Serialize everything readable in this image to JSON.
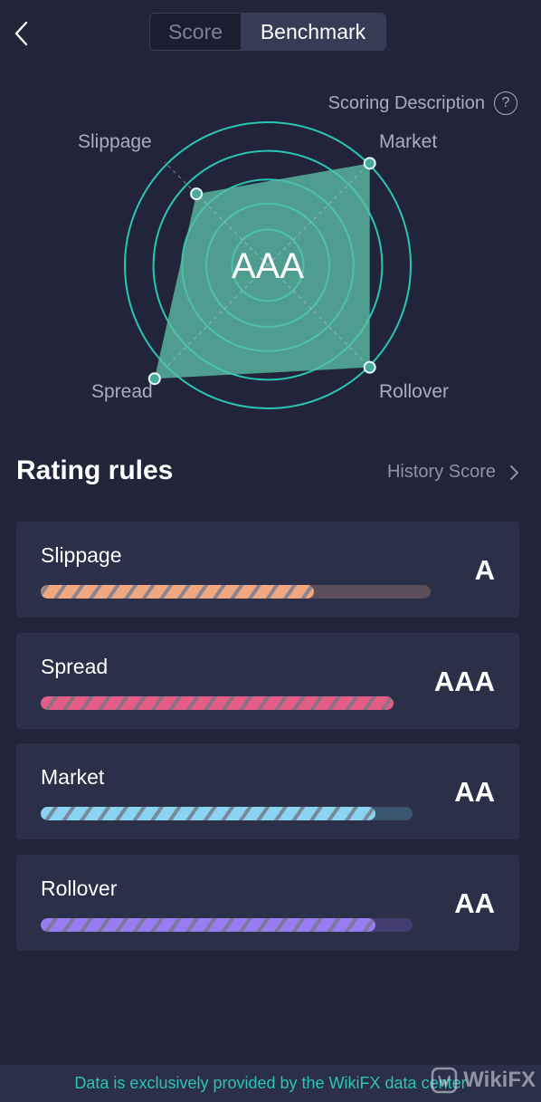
{
  "header": {
    "back_icon": "chevron-left-icon",
    "tabs": [
      {
        "label": "Score",
        "active": false
      },
      {
        "label": "Benchmark",
        "active": true
      }
    ]
  },
  "scoring_description": {
    "label": "Scoring Description",
    "icon": "question-circle-icon",
    "icon_text": "?"
  },
  "radar": {
    "center_grade": "AAA",
    "accent_color": "#2bc5b4",
    "fill_color": "#5bbfa9",
    "axes": [
      {
        "key": "slippage",
        "label": "Slippage",
        "value": 0.63
      },
      {
        "key": "market",
        "label": "Market",
        "value": 0.9
      },
      {
        "key": "rollover",
        "label": "Rollover",
        "value": 0.9
      },
      {
        "key": "spread",
        "label": "Spread",
        "value": 1.0
      }
    ]
  },
  "rating_rules": {
    "title": "Rating rules",
    "history_label": "History Score",
    "items": [
      {
        "label": "Slippage",
        "grade": "A",
        "progress": 0.7,
        "color": "#f0a880",
        "track_color": "#5c4d5a"
      },
      {
        "label": "Spread",
        "grade": "AAA",
        "progress": 1.0,
        "color": "#e45d86",
        "track_color": "#5a3450"
      },
      {
        "label": "Market",
        "grade": "AA",
        "progress": 0.9,
        "color": "#8ad4f2",
        "track_color": "#3c5670"
      },
      {
        "label": "Rollover",
        "grade": "AA",
        "progress": 0.9,
        "color": "#9a7cf2",
        "track_color": "#433d70"
      }
    ]
  },
  "footer": {
    "text": "Data is exclusively provided by the WikiFX data center"
  },
  "watermark": {
    "text": "WikiFX"
  }
}
